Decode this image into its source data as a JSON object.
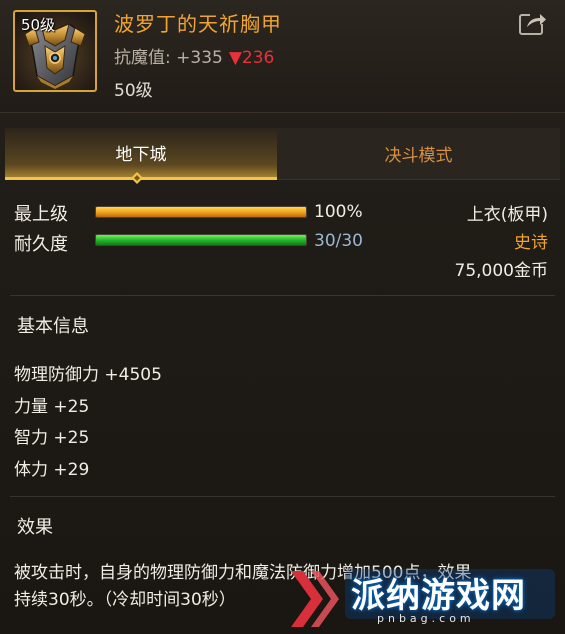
{
  "item": {
    "level_tag": "50级",
    "name": "波罗丁的天祈胸甲",
    "resist_label": "抗魔值: +335",
    "resist_down_arrow": "▼",
    "resist_down_value": "236",
    "level": "50级"
  },
  "tabs": [
    {
      "label": "地下城",
      "active": true
    },
    {
      "label": "决斗模式",
      "active": false
    }
  ],
  "stats": {
    "max_level_label": "最上级",
    "max_level_value": "100%",
    "max_level_fraction": 1.0,
    "durability_label": "耐久度",
    "durability_value": "30/30",
    "durability_fraction": 1.0
  },
  "info": {
    "slot": "上衣(板甲)",
    "rarity": "史诗",
    "price": "75,000金币"
  },
  "basic": {
    "title": "基本信息",
    "attrs": [
      "物理防御力 +4505",
      "力量 +25",
      "智力 +25",
      "体力 +29"
    ]
  },
  "effect": {
    "title": "效果",
    "line1": "被攻击时，自身的物理防御力和魔法防御力增加500点，效果",
    "line2": "持续30秒。（冷却时间30秒）"
  },
  "watermark": {
    "text": "派纳游戏网",
    "url": "pnbag.com"
  },
  "colors": {
    "accent_gold": "#f0a431",
    "frame_gold": "#d8a437",
    "down_red": "#e8313a",
    "durability_blue": "#9bb7d2",
    "bar_orange": "#f0a020",
    "bar_green": "#22b22a"
  },
  "icons": {
    "share": "share-icon",
    "item": "chest-armor-icon"
  }
}
